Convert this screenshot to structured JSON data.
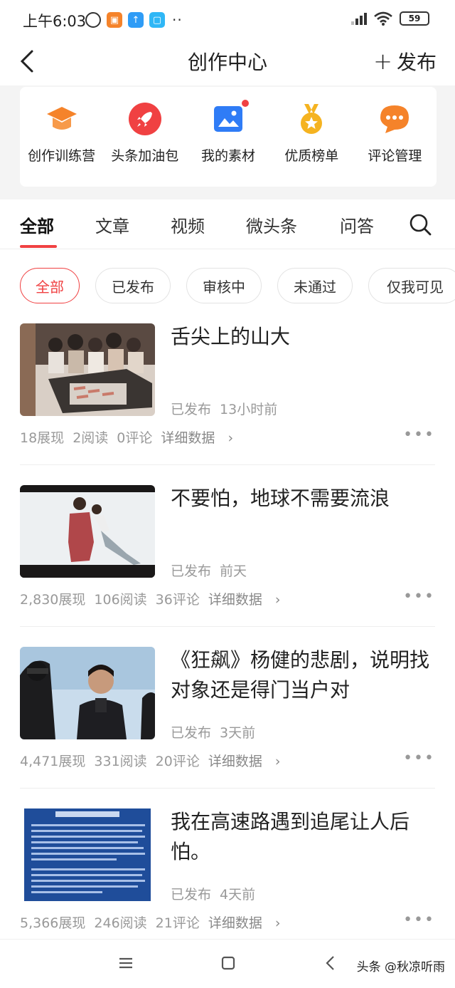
{
  "status_bar": {
    "time": "上午6:03",
    "battery": "59"
  },
  "nav": {
    "title": "创作中心",
    "publish_label": "发布"
  },
  "tools": [
    {
      "label": "创作训练营",
      "icon": "graduation-cap-icon",
      "color": "#f5832a"
    },
    {
      "label": "头条加油包",
      "icon": "rocket-icon",
      "color": "#f04142"
    },
    {
      "label": "我的素材",
      "icon": "image-icon",
      "color": "#2f7cf6",
      "badge": true
    },
    {
      "label": "优质榜单",
      "icon": "medal-icon",
      "color": "#f5b320"
    },
    {
      "label": "评论管理",
      "icon": "comment-bubble-icon",
      "color": "#f5832a"
    }
  ],
  "main_tabs": [
    "全部",
    "文章",
    "视频",
    "微头条",
    "问答"
  ],
  "filter_chips": [
    "全部",
    "已发布",
    "审核中",
    "未通过",
    "仅我可见"
  ],
  "articles": [
    {
      "title": "舌尖上的山大",
      "status": "已发布",
      "time": "13小时前",
      "impressions": "18展现",
      "reads": "2阅读",
      "comments": "0评论",
      "detail": "详细数据"
    },
    {
      "title": "不要怕，地球不需要流浪",
      "status": "已发布",
      "time": "前天",
      "impressions": "2,830展现",
      "reads": "106阅读",
      "comments": "36评论",
      "detail": "详细数据"
    },
    {
      "title": "《狂飙》杨健的悲剧，说明找对象还是得门当户对",
      "status": "已发布",
      "time": "3天前",
      "impressions": "4,471展现",
      "reads": "331阅读",
      "comments": "20评论",
      "detail": "详细数据"
    },
    {
      "title": "我在高速路遇到追尾让人后怕。",
      "status": "已发布",
      "time": "4天前",
      "impressions": "5,366展现",
      "reads": "246阅读",
      "comments": "21评论",
      "detail": "详细数据"
    }
  ],
  "watermark": "头条 @秋凉听雨",
  "colors": {
    "accent": "#f04142",
    "muted_text": "#999999"
  }
}
